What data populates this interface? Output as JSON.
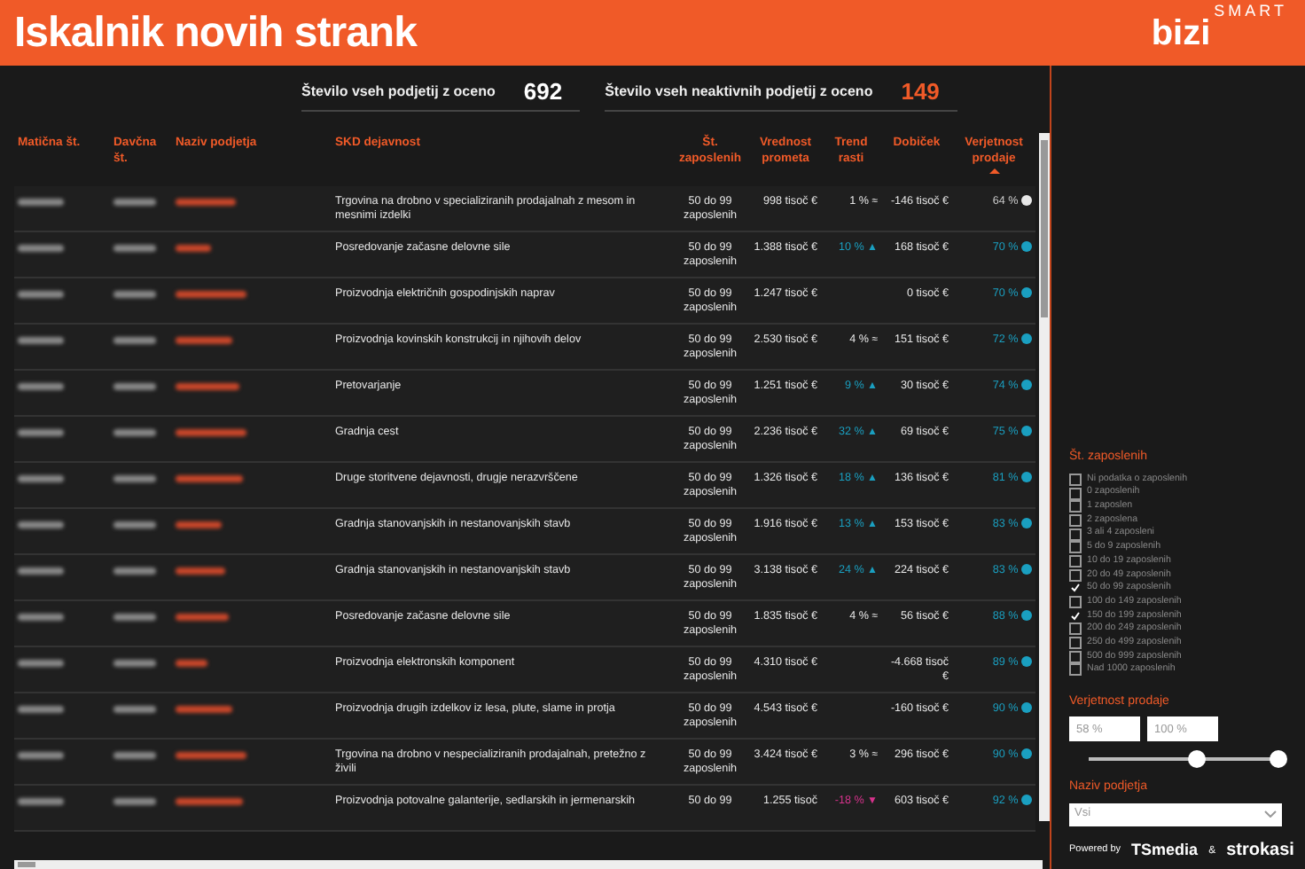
{
  "header": {
    "title": "Iskalnik novih strank",
    "logo": {
      "main": "bizi",
      "sup": "SMART"
    }
  },
  "kpis": [
    {
      "label": "Število vseh podjetij z oceno",
      "value": "692",
      "kind": "plain"
    },
    {
      "label": "Število vseh neaktivnih podjetij z oceno",
      "value": "149",
      "kind": "accent"
    }
  ],
  "table": {
    "columns": [
      {
        "label": "Matična št.",
        "sorted": false
      },
      {
        "label": "Davčna št.",
        "sorted": false
      },
      {
        "label": "Naziv podjetja",
        "sorted": false
      },
      {
        "label": "SKD dejavnost",
        "sorted": false
      },
      {
        "label": "Št. zaposlenih",
        "sorted": false
      },
      {
        "label": "Vrednost prometa",
        "sorted": false
      },
      {
        "label": "Trend rasti",
        "sorted": false
      },
      {
        "label": "Dobiček",
        "sorted": false
      },
      {
        "label": "Verjetnost prodaje",
        "sorted": true
      }
    ],
    "rows": [
      {
        "skd": "Trgovina na drobno v specializiranih prodajalnah z mesom in mesnimi izdelki",
        "employees": "50 do 99 zaposlenih",
        "revenue": "998 tisoč €",
        "trend": {
          "value": "1 %",
          "mark": "≈"
        },
        "profit": "-146 tisoč €",
        "probability": "64 %",
        "color": "#e8e8e8"
      },
      {
        "skd": "Posredovanje začasne delovne sile",
        "employees": "50 do 99 zaposlenih",
        "revenue": "1.388 tisoč €",
        "trend": {
          "value": "10 %",
          "mark": "▲",
          "color": "#1a9fc0"
        },
        "profit": "168 tisoč €",
        "probability": "70 %",
        "color": "#1a9fc0"
      },
      {
        "skd": "Proizvodnja električnih gospodinjskih naprav",
        "employees": "50 do 99 zaposlenih",
        "revenue": "1.247 tisoč €",
        "profit": "0 tisoč €",
        "probability": "70 %",
        "color": "#1a9fc0"
      },
      {
        "skd": "Proizvodnja kovinskih konstrukcij in njihovih delov",
        "employees": "50 do 99 zaposlenih",
        "revenue": "2.530 tisoč €",
        "trend": {
          "value": "4 %",
          "mark": "≈"
        },
        "profit": "151 tisoč €",
        "probability": "72 %",
        "color": "#1a9fc0"
      },
      {
        "skd": "Pretovarjanje",
        "employees": "50 do 99 zaposlenih",
        "revenue": "1.251 tisoč €",
        "trend": {
          "value": "9 %",
          "mark": "▲",
          "color": "#1a9fc0"
        },
        "profit": "30 tisoč €",
        "probability": "74 %",
        "color": "#1a9fc0"
      },
      {
        "skd": "Gradnja cest",
        "employees": "50 do 99 zaposlenih",
        "revenue": "2.236 tisoč €",
        "trend": {
          "value": "32 %",
          "mark": "▲",
          "color": "#1a9fc0"
        },
        "profit": "69 tisoč €",
        "probability": "75 %",
        "color": "#1a9fc0"
      },
      {
        "skd": "Druge storitvene dejavnosti, drugje nerazvrščene",
        "employees": "50 do 99 zaposlenih",
        "revenue": "1.326 tisoč €",
        "trend": {
          "value": "18 %",
          "mark": "▲",
          "color": "#1a9fc0"
        },
        "profit": "136 tisoč €",
        "probability": "81 %",
        "color": "#1a9fc0"
      },
      {
        "skd": "Gradnja stanovanjskih in nestanovanjskih stavb",
        "employees": "50 do 99 zaposlenih",
        "revenue": "1.916 tisoč €",
        "trend": {
          "value": "13 %",
          "mark": "▲",
          "color": "#1a9fc0"
        },
        "profit": "153 tisoč €",
        "probability": "83 %",
        "color": "#1a9fc0"
      },
      {
        "skd": "Gradnja stanovanjskih in nestanovanjskih stavb",
        "employees": "50 do 99 zaposlenih",
        "revenue": "3.138 tisoč €",
        "trend": {
          "value": "24 %",
          "mark": "▲",
          "color": "#1a9fc0"
        },
        "profit": "224 tisoč €",
        "probability": "83 %",
        "color": "#1a9fc0"
      },
      {
        "skd": "Posredovanje začasne delovne sile",
        "employees": "50 do 99 zaposlenih",
        "revenue": "1.835 tisoč €",
        "trend": {
          "value": "4 %",
          "mark": "≈"
        },
        "profit": "56 tisoč €",
        "probability": "88 %",
        "color": "#1a9fc0"
      },
      {
        "skd": "Proizvodnja elektronskih komponent",
        "employees": "50 do 99 zaposlenih",
        "revenue": "4.310 tisoč €",
        "profit": "-4.668 tisoč €",
        "probability": "89 %",
        "color": "#1a9fc0"
      },
      {
        "skd": "Proizvodnja drugih izdelkov iz lesa, plute, slame in protja",
        "employees": "50 do 99 zaposlenih",
        "revenue": "4.543 tisoč €",
        "profit": "-160 tisoč €",
        "probability": "90 %",
        "color": "#1a9fc0"
      },
      {
        "skd": "Trgovina na drobno v nespecializiranih prodajalnah, pretežno z živili",
        "employees": "50 do 99 zaposlenih",
        "revenue": "3.424 tisoč €",
        "trend": {
          "value": "3 %",
          "mark": "≈"
        },
        "profit": "296 tisoč €",
        "probability": "90 %",
        "color": "#1a9fc0"
      },
      {
        "skd": "Proizvodnja potovalne galanterije, sedlarskih in jermenarskih",
        "employees": "50 do 99",
        "revenue": "1.255 tisoč",
        "trend": {
          "value": "-18 %",
          "mark": "▼",
          "color": "#d6338c"
        },
        "profit": "603 tisoč €",
        "probability": "92 %",
        "color": "#1a9fc0"
      }
    ]
  },
  "filters": {
    "employees": {
      "title": "Št. zaposlenih",
      "options": [
        {
          "label": "Ni podatka o zaposlenih",
          "checked": false
        },
        {
          "label": "0 zaposlenih",
          "checked": false
        },
        {
          "label": "1 zaposlen",
          "checked": false
        },
        {
          "label": "2 zaposlena",
          "checked": false
        },
        {
          "label": "3 ali 4 zaposleni",
          "checked": false
        },
        {
          "label": "5 do 9 zaposlenih",
          "checked": false
        },
        {
          "label": "10 do 19 zaposlenih",
          "checked": false
        },
        {
          "label": "20 do 49 zaposlenih",
          "checked": false
        },
        {
          "label": "50 do 99 zaposlenih",
          "checked": true
        },
        {
          "label": "100 do 149 zaposlenih",
          "checked": false
        },
        {
          "label": "150 do 199 zaposlenih",
          "checked": true
        },
        {
          "label": "200 do 249 zaposlenih",
          "checked": false
        },
        {
          "label": "250 do 499 zaposlenih",
          "checked": false
        },
        {
          "label": "500 do 999 zaposlenih",
          "checked": false
        },
        {
          "label": "Nad 1000 zaposlenih",
          "checked": false
        }
      ]
    },
    "probability": {
      "title": "Verjetnost prodaje",
      "min": "58 %",
      "max": "100 %",
      "thumbs": [
        {
          "level": 0.57
        },
        {
          "level": 1
        }
      ]
    },
    "company": {
      "title": "Naziv podjetja",
      "value": "Vsi"
    }
  },
  "footer": {
    "powered": "Powered by",
    "brand1": "TSmedia",
    "amp": "&",
    "brand2": "strokasi"
  }
}
